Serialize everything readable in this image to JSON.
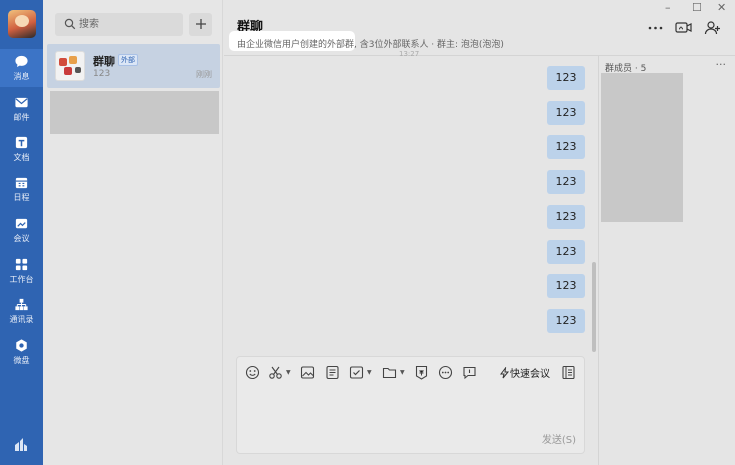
{
  "nav": {
    "items": [
      {
        "label": "消息",
        "icon": "chat-bubble-icon"
      },
      {
        "label": "邮件",
        "icon": "mail-icon"
      },
      {
        "label": "文档",
        "icon": "document-icon"
      },
      {
        "label": "日程",
        "icon": "calendar-icon"
      },
      {
        "label": "会议",
        "icon": "meeting-icon"
      },
      {
        "label": "工作台",
        "icon": "workbench-icon"
      },
      {
        "label": "通讯录",
        "icon": "contacts-icon"
      },
      {
        "label": "微盘",
        "icon": "cloud-drive-icon"
      }
    ],
    "bottom_icon": "app-logo-icon"
  },
  "search": {
    "placeholder": "搜索"
  },
  "conversations": [
    {
      "name": "群聊",
      "tag": "外部",
      "preview": "123",
      "time": "刚刚"
    }
  ],
  "chat": {
    "title": "群聊",
    "subtitle": "由企业微信用户创建的外部群, 含3位外部联系人 · 群主: 泡泡(泡泡)",
    "header_icons": [
      "more-icon",
      "video-call-icon",
      "add-member-icon"
    ],
    "top_stamp": "13:27",
    "messages": [
      "123",
      "123",
      "123",
      "123",
      "123",
      "123",
      "123",
      "123"
    ]
  },
  "members": {
    "title": "群成员 · 5",
    "more": "···"
  },
  "composer": {
    "toolbar_icons": [
      "emoji-icon",
      "scissors-icon",
      "image-icon",
      "note-icon",
      "todo-icon",
      "folder-icon",
      "red-packet-icon",
      "more-circle-icon",
      "reply-icon"
    ],
    "quick_meeting": "快速会议",
    "send": "发送(S)"
  },
  "window": {
    "minimize": "–",
    "maximize": "☐",
    "close": "✕"
  },
  "colors": {
    "nav": "#2f64b2",
    "bubble": "#bcd2ea",
    "selected": "#c6d2e2"
  }
}
